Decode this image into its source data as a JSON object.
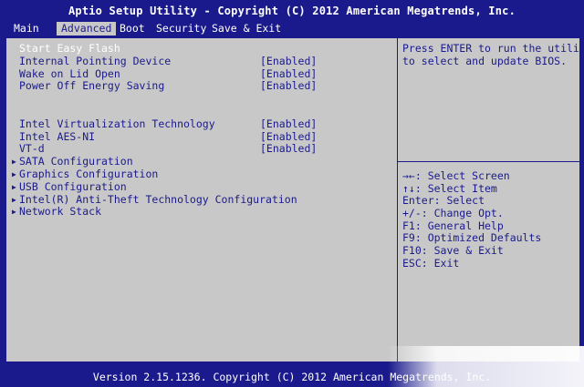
{
  "title": "Aptio Setup Utility - Copyright (C) 2012 American Megatrends, Inc.",
  "tabs": [
    {
      "label": "Main",
      "active": false
    },
    {
      "label": "Advanced",
      "active": true
    },
    {
      "label": "Boot",
      "active": false
    },
    {
      "label": "Security",
      "active": false
    },
    {
      "label": "Save & Exit",
      "active": false
    }
  ],
  "settings": [
    {
      "label": "Start Easy Flash",
      "value": "",
      "selected": true,
      "submenu": false
    },
    {
      "label": "Internal Pointing Device",
      "value": "[Enabled]"
    },
    {
      "label": "Wake on Lid Open",
      "value": "[Enabled]"
    },
    {
      "label": "Power Off Energy Saving",
      "value": "[Enabled]"
    },
    {
      "label": "Intel Virtualization Technology",
      "value": "[Enabled]"
    },
    {
      "label": "Intel AES-NI",
      "value": "[Enabled]"
    },
    {
      "label": "VT-d",
      "value": "[Enabled]"
    },
    {
      "label": "SATA Configuration",
      "submenu": true
    },
    {
      "label": "Graphics Configuration",
      "submenu": true
    },
    {
      "label": "USB Configuration",
      "submenu": true
    },
    {
      "label": "Intel(R) Anti-Theft Technology Configuration",
      "submenu": true
    },
    {
      "label": "Network Stack",
      "submenu": true
    }
  ],
  "help": {
    "line1": "Press ENTER to run the utility",
    "line2": "to select and update BIOS."
  },
  "keys": [
    "→←: Select Screen",
    "↑↓: Select Item",
    "Enter: Select",
    "+/-: Change Opt.",
    "F1: General Help",
    "F9: Optimized Defaults",
    "F10: Save & Exit",
    "ESC: Exit"
  ],
  "footer": "Version 2.15.1236. Copyright (C) 2012 American Megatrends, Inc."
}
